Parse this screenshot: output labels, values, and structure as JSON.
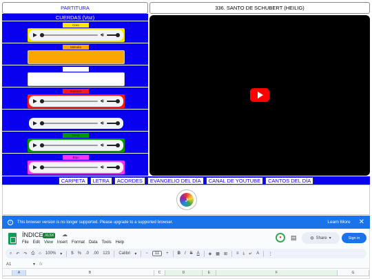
{
  "header": {
    "left_title": "PARTITURA",
    "right_title": "336. SANTO DE SCHUBERT (HEILIG)"
  },
  "panel": {
    "title": "CUERDAS (Voz)",
    "tracks": [
      {
        "label": "Coro",
        "color": "#ffe600",
        "has_player": true
      },
      {
        "label": "Melodía",
        "color": "#ffa500",
        "has_player": false
      },
      {
        "label": "",
        "color": "#ffffff",
        "has_player": false
      },
      {
        "label": "Soprano",
        "color": "#ff1a1a",
        "has_player": true
      },
      {
        "label": "",
        "color": "#0a00f0",
        "has_player": true
      },
      {
        "label": "Tenor",
        "color": "#009900",
        "has_player": true
      },
      {
        "label": "Bajo",
        "color": "#ff33ff",
        "has_player": true
      }
    ]
  },
  "nav": {
    "buttons": [
      "CARPETA",
      "LETRA",
      "ACORDES",
      "EVANGELIO DEL DÍA",
      "CANAL DE YOUTUBE",
      "CANTOS DEL DÍA"
    ]
  },
  "icons": {
    "play": "play-icon",
    "volume": "volume-icon",
    "youtube": "youtube-play-icon",
    "logo": "music-logo-icon",
    "info": "info-icon",
    "close": "close-icon"
  },
  "banner": {
    "message": "This browser version is no longer supported. Please upgrade to a supported browser.",
    "learn_more": "Learn More",
    "close": "✕",
    "info": "i"
  },
  "sheets": {
    "doc_title": "ÍNDICE",
    "badge": ".XLSX",
    "menu": [
      "File",
      "Edit",
      "View",
      "Insert",
      "Format",
      "Data",
      "Tools",
      "Help"
    ],
    "share_label": "Share",
    "signin_label": "Sign in",
    "zoom": "100%",
    "font": "Calibri",
    "font_size": "11",
    "name_box": "A1",
    "fx": "fx",
    "toolbar_currency": "$",
    "toolbar_percent": "%",
    "toolbar_decimals_down": ".0",
    "toolbar_decimals_up": ".00",
    "toolbar_format": "123",
    "columns": [
      "A",
      "B",
      "C",
      "D",
      "E",
      "F",
      "G"
    ]
  },
  "colors": {
    "panel_blue": "#0a00f0",
    "youtube_red": "#ff0000",
    "sheets_blue": "#1a73e8",
    "sheets_green": "#0f9d58"
  }
}
